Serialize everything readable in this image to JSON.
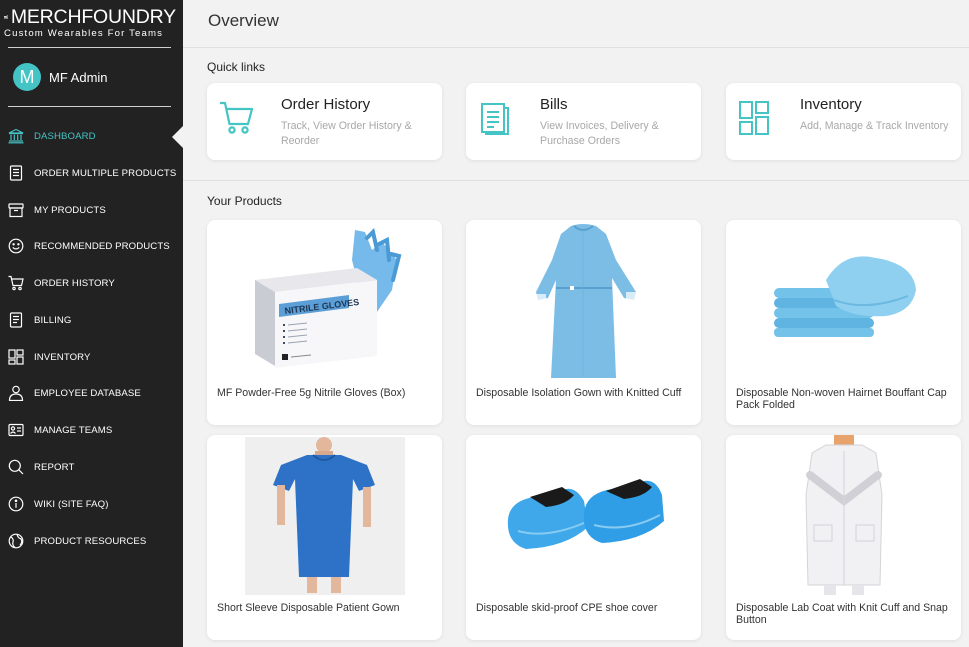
{
  "brand": {
    "name": "MERCHFOUNDRY",
    "tagline": "Custom Wearables For Teams",
    "accent": "#45c4c6",
    "sidebar_bg": "#222222"
  },
  "user": {
    "initial": "M",
    "name": "MF Admin"
  },
  "nav": [
    {
      "label": "DASHBOARD",
      "icon": "bank-icon",
      "active": true
    },
    {
      "label": "ORDER MULTIPLE PRODUCTS",
      "icon": "list-icon"
    },
    {
      "label": "MY PRODUCTS",
      "icon": "box-icon"
    },
    {
      "label": "RECOMMENDED PRODUCTS",
      "icon": "smile-icon"
    },
    {
      "label": "ORDER HISTORY",
      "icon": "cart-icon"
    },
    {
      "label": "BILLING",
      "icon": "document-icon"
    },
    {
      "label": "INVENTORY",
      "icon": "grid-icon"
    },
    {
      "label": "EMPLOYEE DATABASE",
      "icon": "person-icon"
    },
    {
      "label": "MANAGE TEAMS",
      "icon": "id-card-icon"
    },
    {
      "label": "REPORT",
      "icon": "magnifier-icon"
    },
    {
      "label": "WIKI (SITE FAQ)",
      "icon": "info-icon"
    },
    {
      "label": "PRODUCT RESOURCES",
      "icon": "globe-icon"
    }
  ],
  "main": {
    "title": "Overview",
    "quick_links_title": "Quick links",
    "quick_links": [
      {
        "title": "Order History",
        "desc": "Track, View Order History & Reorder",
        "icon": "cart-icon"
      },
      {
        "title": "Bills",
        "desc": "View Invoices, Delivery & Purchase Orders",
        "icon": "document-icon"
      },
      {
        "title": "Inventory",
        "desc": "Add, Manage & Track Inventory",
        "icon": "grid-icon"
      }
    ],
    "products_title": "Your Products",
    "products": [
      {
        "name": "MF Powder-Free 5g Nitrile Gloves (Box)",
        "box_text": "NITRILE GLOVES"
      },
      {
        "name": " Disposable Isolation Gown with Knitted Cuff"
      },
      {
        "name": " Disposable Non-woven Hairnet Bouffant Cap Pack Folded"
      },
      {
        "name": "Short Sleeve Disposable Patient Gown"
      },
      {
        "name": "Disposable skid-proof CPE shoe cover"
      },
      {
        "name": " Disposable Lab Coat with Knit Cuff and Snap Button"
      }
    ]
  }
}
